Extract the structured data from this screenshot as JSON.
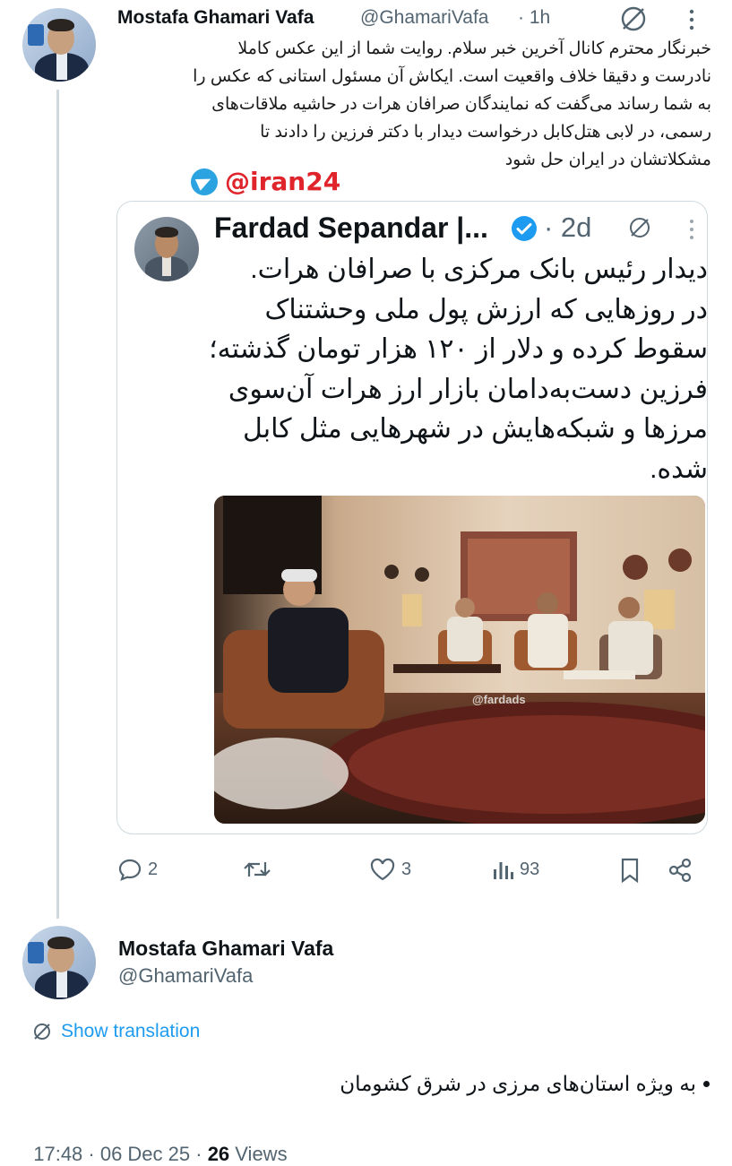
{
  "reply": {
    "author_name": "Mostafa Ghamari Vafa",
    "handle": "@GhamariVafa",
    "time": "· 1h",
    "text_lines": [
      "خبرنگار محترم کانال آخرین خبر سلام. روایت شما از این عکس کاملا",
      "نادرست و دقیقا خلاف واقعیت است. ایکاش آن مسئول استانی که عکس را",
      "به شما رساند می‌گفت که نمایندگان صرافان هرات در حاشیه ملاقات‌های",
      "رسمی، در لابی هتل‌کابل درخواست دیدار با دکتر فرزین را دادند تا",
      "مشکلاتشان در ایران حل شود"
    ],
    "watermark_handle": "@iran24"
  },
  "quote": {
    "author_name": "Fardad Sepandar |...",
    "time": "· 2d",
    "text_lines": [
      "دیدار رئیس بانک مرکزی با صرافان هرات.",
      "در روزهایی که ارزش پول ملی وحشتناک",
      "سقوط کرده و دلار از ۱۲۰ هزار تومان گذشته؛",
      "فرزین دست‌به‌دامان بازار ارز هرات آن‌سوی",
      "مرزها و شبکه‌هایش در شهرهایی مثل کابل",
      "شده."
    ],
    "image_watermark": "@fardads"
  },
  "actions": {
    "replies": "2",
    "reposts": "",
    "likes": "3",
    "views": "93"
  },
  "main": {
    "author_name": "Mostafa Ghamari Vafa",
    "handle": "@GhamariVafa",
    "show_translation": "Show translation",
    "bullet_text": "به ویژه استان‌های مرزی در شرق کشومان",
    "timestamp": "17:48 · 06 Dec 25 · ",
    "views_count": "26",
    "views_label": " Views"
  },
  "colors": {
    "text": "#0f1419",
    "secondary": "#536471",
    "link": "#1d9bf0",
    "verified": "#1d9bf0",
    "watermark_red": "#e0242b",
    "telegram": "#2aa3e0"
  }
}
